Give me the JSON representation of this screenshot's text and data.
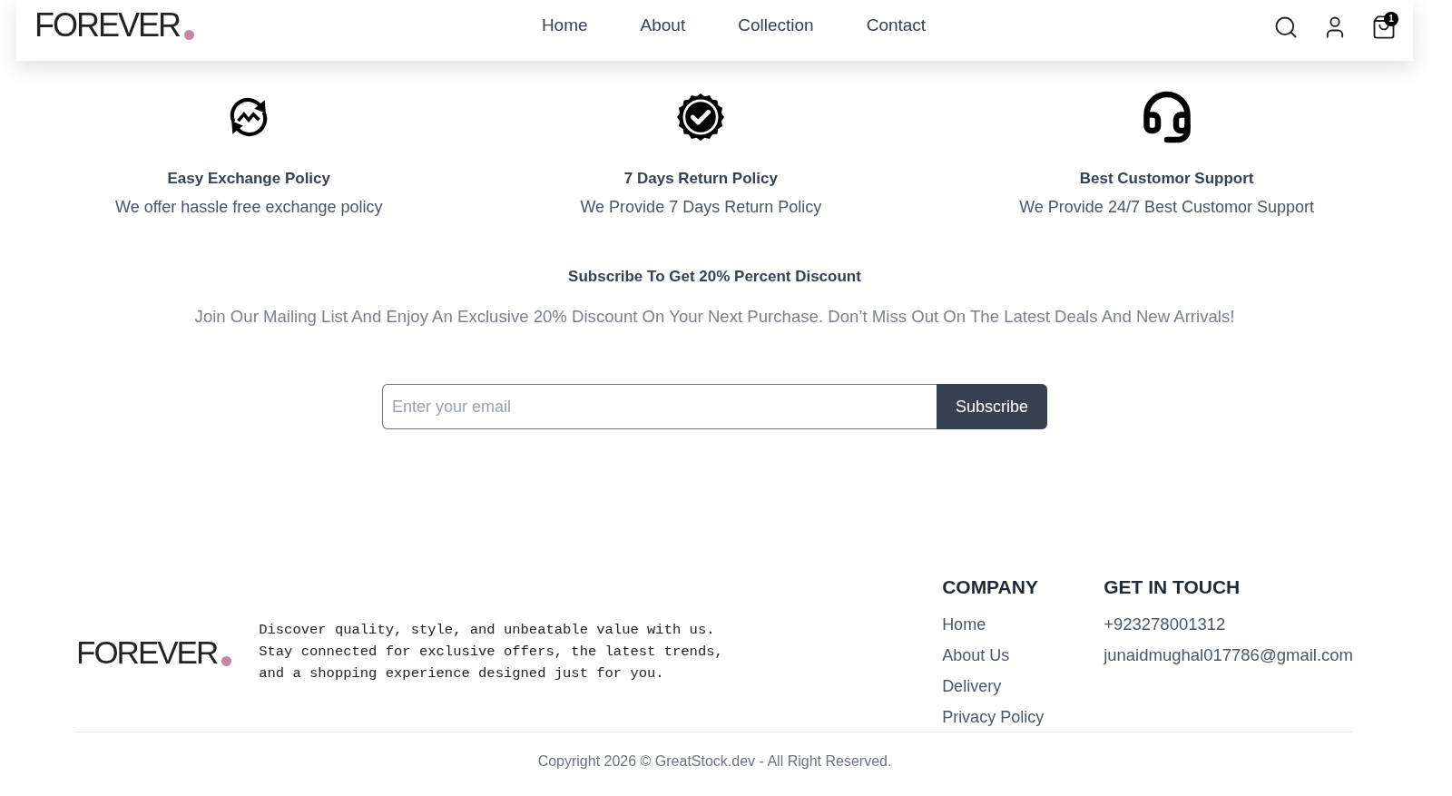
{
  "header": {
    "logo": "FOREVER",
    "nav": [
      {
        "label": "Home"
      },
      {
        "label": "About"
      },
      {
        "label": "Collection"
      },
      {
        "label": "Contact"
      }
    ],
    "cart_count": "1"
  },
  "features": [
    {
      "kind": "exchange",
      "title": "Easy Exchange Policy",
      "description": "We offer hassle free exchange policy"
    },
    {
      "kind": "quality",
      "title": "7 Days Return Policy",
      "description": "We Provide 7 Days Return Policy"
    },
    {
      "kind": "support",
      "title": "Best Customor Support",
      "description": "We Provide 24/7 Best Customor Support"
    }
  ],
  "subscribe": {
    "title": "Subscribe To Get 20% Percent Discount",
    "text": "Join Our Mailing List And Enjoy An Exclusive 20% Discount On Your Next Purchase. Don’t Miss Out On The Latest Deals And New Arrivals!",
    "email": {
      "placeholder": "Enter your email"
    },
    "button": "Subscribe"
  },
  "footer": {
    "logo": "FOREVER",
    "about": "Discover quality, style, and unbeatable value with us. Stay connected for exclusive offers, the latest trends, and a shopping experience designed just for you.",
    "company": {
      "heading": "COMPANY",
      "links": [
        "Home",
        "About Us",
        "Delivery",
        "Privacy Policy"
      ]
    },
    "contact": {
      "heading": "GET IN TOUCH",
      "items": [
        "+923278001312",
        "junaidmughal017786@gmail.com"
      ]
    },
    "copyright": "Copyright 2026 © GreatStock.dev - All Right Reserved."
  }
}
